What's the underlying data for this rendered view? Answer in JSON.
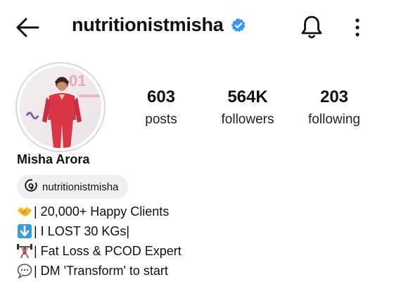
{
  "header": {
    "username": "nutritionistmisha",
    "verified": true,
    "icons": [
      "back-arrow-icon",
      "verified-badge-icon",
      "bell-icon",
      "more-vertical-icon"
    ]
  },
  "profile": {
    "name": "Misha Arora",
    "threads_label": "nutritionistmisha"
  },
  "stats": [
    {
      "value": "603",
      "label": "posts"
    },
    {
      "value": "564K",
      "label": "followers"
    },
    {
      "value": "203",
      "label": "following"
    }
  ],
  "bio": [
    {
      "icon": "handshake-emoji",
      "text": "| 20,000+ Happy Clients"
    },
    {
      "icon": "down-arrow-emoji",
      "text": "| I LOST 30 KGs|"
    },
    {
      "icon": "weightlifter-emoji",
      "text": "| Fat Loss & PCOD Expert"
    },
    {
      "icon": "speech-bubble-emoji",
      "text": " | DM 'Transform' to start"
    }
  ],
  "colors": {
    "verified_blue": "#3897f0",
    "pill_bg": "#efefef",
    "avatar_dress": "#d93647"
  }
}
